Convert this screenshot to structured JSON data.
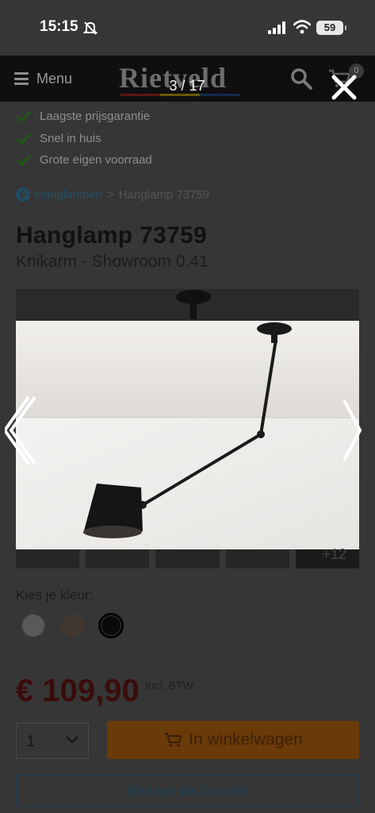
{
  "status_bar": {
    "time": "15:15",
    "battery": "59"
  },
  "header": {
    "menu_label": "Menu",
    "logo_text": "Rietveld",
    "cart_count": "0",
    "logo_colors": [
      "#c01a1a",
      "#d8b400",
      "#1d4a9a"
    ]
  },
  "gallery": {
    "counter": "3 / 17",
    "thumbnail_more": "+12"
  },
  "usps": [
    "Laagste prijsgarantie",
    "Snel in huis",
    "Grote eigen voorraad"
  ],
  "breadcrumb": {
    "parent": "Hanglampen",
    "separator": ">",
    "current": "Hanglamp 73759"
  },
  "product": {
    "title": "Hanglamp 73759",
    "subtitle": "Knikarm - Showroom 0.41",
    "color_label": "Kies je kleur:",
    "colors": [
      "#9a9a9a",
      "#5a3a20",
      "#0a0a0a"
    ],
    "selected_color_index": 2,
    "price": "€ 109,90",
    "vat_note": "Incl. BTW"
  },
  "purchase": {
    "quantity": "1",
    "add_to_cart_label": "In winkelwagen",
    "save_favorite_label": "Bewaar als favoriet"
  }
}
